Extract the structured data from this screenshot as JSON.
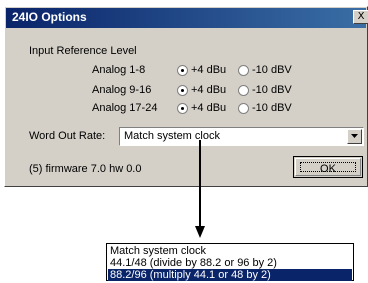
{
  "dialog": {
    "title": "24IO Options",
    "close_glyph": "X",
    "section_heading": "Input Reference Level",
    "rows": [
      {
        "label": "Analog 1-8",
        "opt1": "+4 dBu",
        "opt2": "-10 dBV",
        "selected": "+4 dBu"
      },
      {
        "label": "Analog 9-16",
        "opt1": "+4 dBu",
        "opt2": "-10 dBV",
        "selected": "+4 dBu"
      },
      {
        "label": "Analog 17-24",
        "opt1": "+4 dBu",
        "opt2": "-10 dBV",
        "selected": "+4 dBu"
      }
    ],
    "word_out_label": "Word Out Rate:",
    "word_out_value": "Match system clock",
    "firmware_text": "(5) firmware 7.0 hw 0.0",
    "ok_label": "OK"
  },
  "dropdown": {
    "options": [
      "Match system clock",
      "44.1/48 (divide by 88.2 or 96 by 2)",
      "88.2/96 (multiply 44.1 or 48 by 2)"
    ],
    "selected_index": 2
  },
  "colors": {
    "titlebar_start": "#0a246a",
    "titlebar_end": "#3a6ea5",
    "dialog_face": "#d4d0c8",
    "selection": "#0a246a"
  }
}
